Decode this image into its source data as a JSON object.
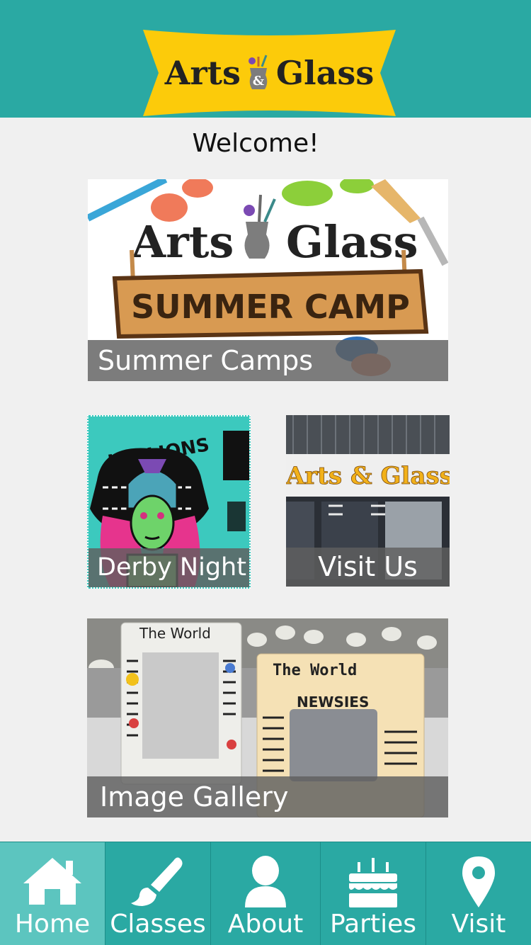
{
  "header": {
    "logo_text_left": "Arts",
    "logo_text_right": "Glass",
    "logo_amp": "&"
  },
  "welcome": "Welcome!",
  "tiles": {
    "camp": {
      "caption": "Summer Camps",
      "logo_left": "Arts",
      "logo_right": "Glass",
      "sign_text": "SUMMER CAMP"
    },
    "derby": {
      "caption": "Derby Night",
      "poster_text": "HELLIONS"
    },
    "visit": {
      "caption": "Visit Us",
      "sign_text": "Arts & Glass"
    },
    "gallery": {
      "caption": "Image Gallery",
      "frame1_title": "The World",
      "frame2_title": "The World",
      "frame2_sub": "NEWSIES"
    }
  },
  "tabs": [
    {
      "label": "Home",
      "icon": "home-icon",
      "active": true
    },
    {
      "label": "Classes",
      "icon": "paintbrush-icon",
      "active": false
    },
    {
      "label": "About",
      "icon": "person-icon",
      "active": false
    },
    {
      "label": "Parties",
      "icon": "cake-icon",
      "active": false
    },
    {
      "label": "Visit",
      "icon": "map-pin-icon",
      "active": false
    }
  ],
  "colors": {
    "header_bg": "#2aa9a3",
    "tab_active_bg": "#5cc5bf",
    "logo_yellow": "#fccb0a"
  }
}
